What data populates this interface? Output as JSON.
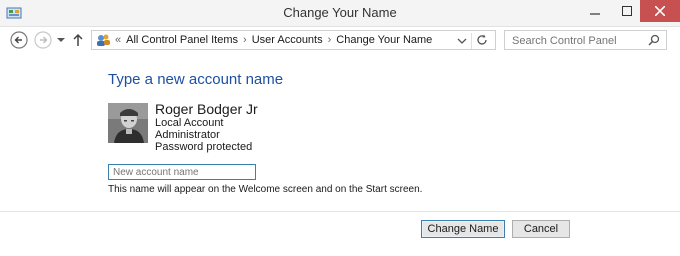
{
  "window": {
    "title": "Change Your Name"
  },
  "navigation": {
    "breadcrumbs": [
      "All Control Panel Items",
      "User Accounts",
      "Change Your Name"
    ],
    "search_placeholder": "Search Control Panel",
    "overflow_glyph": "«",
    "separator_glyph": "›"
  },
  "main": {
    "heading": "Type a new account name",
    "user": {
      "display_name": "Roger Bodger Jr",
      "lines": [
        "Local Account",
        "Administrator",
        "Password protected"
      ]
    },
    "name_input_placeholder": "New account name",
    "hint": "This name will appear on the Welcome screen and on the Start screen."
  },
  "buttons": {
    "change_name": "Change Name",
    "cancel": "Cancel"
  },
  "colors": {
    "heading": "#1e50a2",
    "close_button": "#c75050",
    "focus_border": "#3c7fb1"
  }
}
